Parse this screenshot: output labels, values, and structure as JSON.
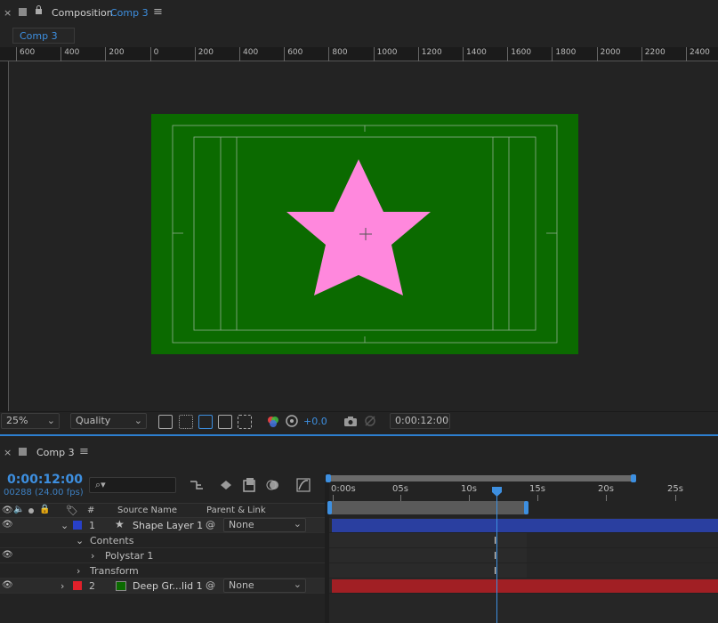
{
  "composition_panel": {
    "title": "Composition",
    "comp_name": "Comp 3",
    "tab_label": "Comp 3",
    "ruler_labels": [
      "600",
      "400",
      "200",
      "0",
      "200",
      "400",
      "600",
      "800",
      "1000",
      "1200",
      "1400",
      "1600",
      "1800",
      "2000",
      "2200",
      "2400"
    ]
  },
  "viewer": {
    "background_color": "#0b6a00",
    "star_color": "#ff88dd"
  },
  "viewer_toolbar": {
    "magnification": "25%",
    "resolution": "Quality",
    "exposure": "+0.0",
    "timecode": "0:00:12:00"
  },
  "timeline": {
    "comp_name": "Comp 3",
    "current_time": "0:00:12:00",
    "frame_info": "00288 (24.00 fps)",
    "search_placeholder": "",
    "columns": {
      "number": "#",
      "source_name": "Source Name",
      "parent": "Parent & Link"
    },
    "ruler_labels": [
      "0:00s",
      "05s",
      "10s",
      "15s",
      "20s",
      "25s"
    ],
    "layers": [
      {
        "number": "1",
        "name": "Shape Layer 1",
        "label_color": "#2840c8",
        "parent": "None",
        "bar_color": "#2a3fa0"
      },
      {
        "number": "2",
        "name": "Deep Gr...lid 1",
        "label_color": "#e0202a",
        "parent": "None",
        "bar_color": "#a11f24",
        "swatch_color": "#0b6a00"
      }
    ],
    "sub_rows": [
      "Contents",
      "Polystar 1",
      "Transform"
    ]
  }
}
